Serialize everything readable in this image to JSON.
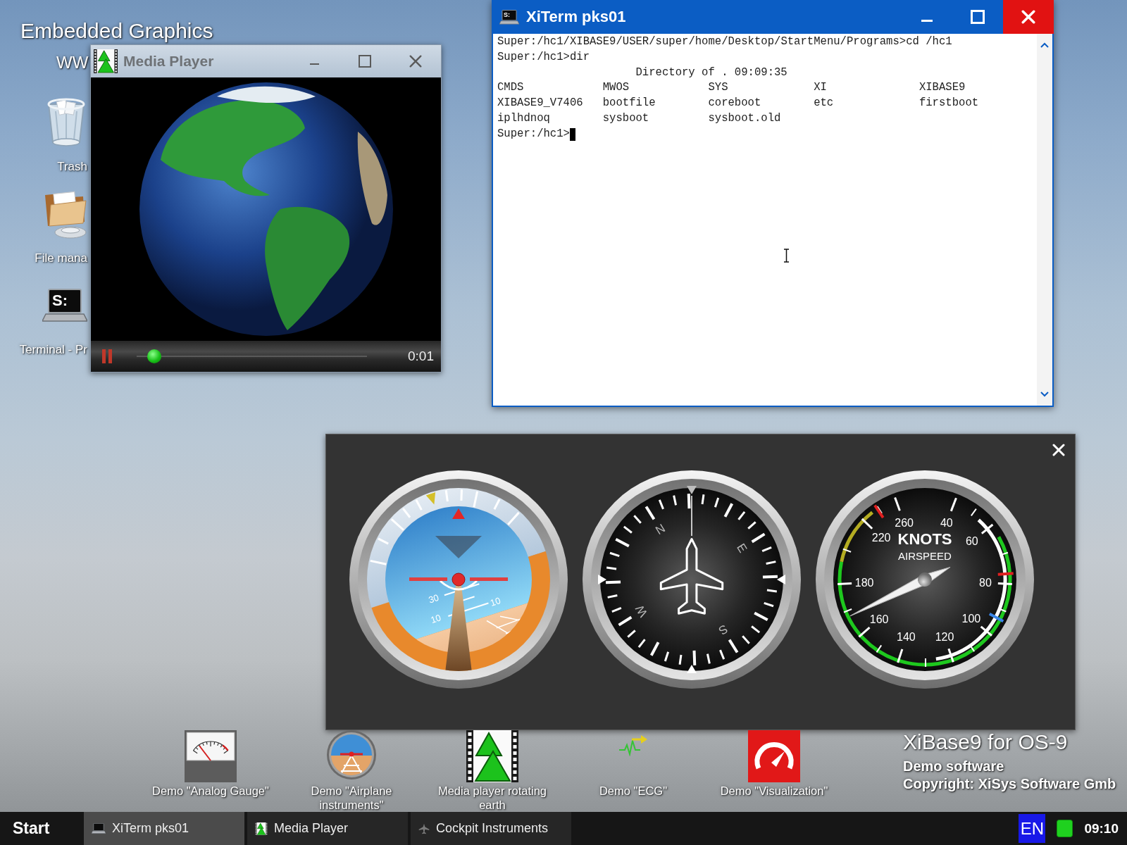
{
  "desktop": {
    "heading": "Embedded Graphics",
    "subheading": "WW",
    "icons": [
      {
        "kind": "trash",
        "label": "Trash"
      },
      {
        "kind": "folder",
        "label": "File mana"
      },
      {
        "kind": "terminal",
        "label": "Terminal - Pr",
        "screen_text": "S:"
      }
    ]
  },
  "media_player": {
    "title": "Media Player",
    "playing": true,
    "level": 0.05,
    "time": "0:01"
  },
  "terminal_window": {
    "title": "XiTerm pks01",
    "icon_text": "S:",
    "lines": [
      {
        "kind": "text",
        "text": "Super:/hc1/XIBASE9/USER/super/home/Desktop/StartMenu/Programs>cd /hc1"
      },
      {
        "kind": "text",
        "text": "Super:/hc1>dir"
      },
      {
        "kind": "heading",
        "text": "Directory of . 09:09:35"
      },
      {
        "kind": "columns",
        "cells": [
          "CMDS",
          "MWOS",
          "SYS",
          "XI",
          "XIBASE9"
        ]
      },
      {
        "kind": "columns",
        "cells": [
          "XIBASE9_V7406",
          "bootfile",
          "coreboot",
          "etc",
          "firstboot"
        ]
      },
      {
        "kind": "columns",
        "cells": [
          "iplhdnoq",
          "sysboot",
          "sysboot.old"
        ]
      },
      {
        "kind": "prompt",
        "text": "Super:/hc1>"
      }
    ]
  },
  "cockpit_window": {
    "gauges": [
      {
        "kind": "attitude",
        "labels": [
          "30",
          "10",
          "10"
        ]
      },
      {
        "kind": "heading",
        "labels": [
          "N",
          "E",
          "S",
          "W"
        ]
      },
      {
        "kind": "airspeed",
        "unit": "KNOTS",
        "caption": "AIRSPEED",
        "labels": [
          "40",
          "60",
          "80",
          "100",
          "120",
          "140",
          "160",
          "180",
          "220",
          "260"
        ]
      }
    ]
  },
  "launchers": [
    {
      "kind": "gauge",
      "label": "Demo \"Analog Gauge\""
    },
    {
      "kind": "horizon",
      "label": "Demo \"Airplane instruments\""
    },
    {
      "kind": "film",
      "label": "Media player rotating earth"
    },
    {
      "kind": "ecg",
      "label": "Demo \"ECG\""
    },
    {
      "kind": "dial",
      "label": "Demo \"Visualization\""
    }
  ],
  "branding": {
    "title": "XiBase9 for OS-9",
    "lines": [
      "Demo software",
      "Copyright: XiSys Software Gmb"
    ]
  },
  "taskbar": {
    "start": "Start",
    "tasks": [
      {
        "kind": "terminal",
        "label": "XiTerm pks01",
        "selected": true
      },
      {
        "kind": "film",
        "label": "Media Player",
        "selected": false
      },
      {
        "kind": "airplane",
        "label": "Cockpit Instruments",
        "selected": false
      }
    ],
    "language": "EN",
    "time": "09:10"
  }
}
